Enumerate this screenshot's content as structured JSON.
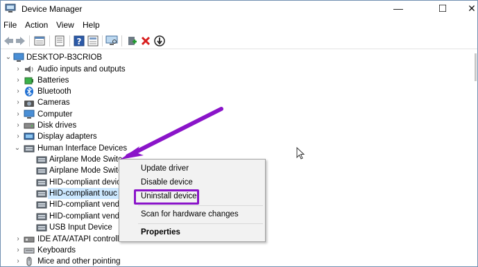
{
  "window": {
    "title": "Device Manager",
    "minimize_glyph": "—",
    "maximize_glyph": "☐",
    "close_glyph": "✕"
  },
  "menu": [
    "File",
    "Action",
    "View",
    "Help"
  ],
  "toolbar_icons": [
    "back-icon",
    "forward-icon",
    "properties-sheet-icon",
    "device-list-icon",
    "help-icon",
    "details-icon",
    "scan-hardware-icon",
    "update-driver-icon",
    "uninstall-icon",
    "disable-icon"
  ],
  "tree": {
    "root": "DESKTOP-B3CRIOB",
    "categories": [
      {
        "label": "Audio inputs and outputs",
        "icon": "speaker-icon"
      },
      {
        "label": "Batteries",
        "icon": "battery-icon"
      },
      {
        "label": "Bluetooth",
        "icon": "bluetooth-icon"
      },
      {
        "label": "Cameras",
        "icon": "camera-icon"
      },
      {
        "label": "Computer",
        "icon": "computer-icon"
      },
      {
        "label": "Disk drives",
        "icon": "disk-drive-icon"
      },
      {
        "label": "Display adapters",
        "icon": "display-adapter-icon"
      },
      {
        "label": "Human Interface Devices",
        "icon": "hid-icon"
      },
      {
        "label": "IDE ATA/ATAPI controller",
        "icon": "ide-controller-icon"
      },
      {
        "label": "Keyboards",
        "icon": "keyboard-icon"
      },
      {
        "label": "Mice and other pointing",
        "icon": "mouse-icon"
      }
    ],
    "hid_children": [
      "Airplane Mode Switc",
      "Airplane Mode Switc",
      "HID-compliant devic",
      "HID-compliant touc",
      "HID-compliant vend",
      "HID-compliant vend",
      "USB Input Device"
    ]
  },
  "context_menu": {
    "update": "Update driver",
    "disable": "Disable device",
    "uninstall": "Uninstall device",
    "scan": "Scan for hardware changes",
    "properties": "Properties"
  },
  "colors": {
    "annotation_purple": "#8a14c9",
    "selection": "#cce8ff",
    "uninstall_red": "#d81e1e"
  }
}
